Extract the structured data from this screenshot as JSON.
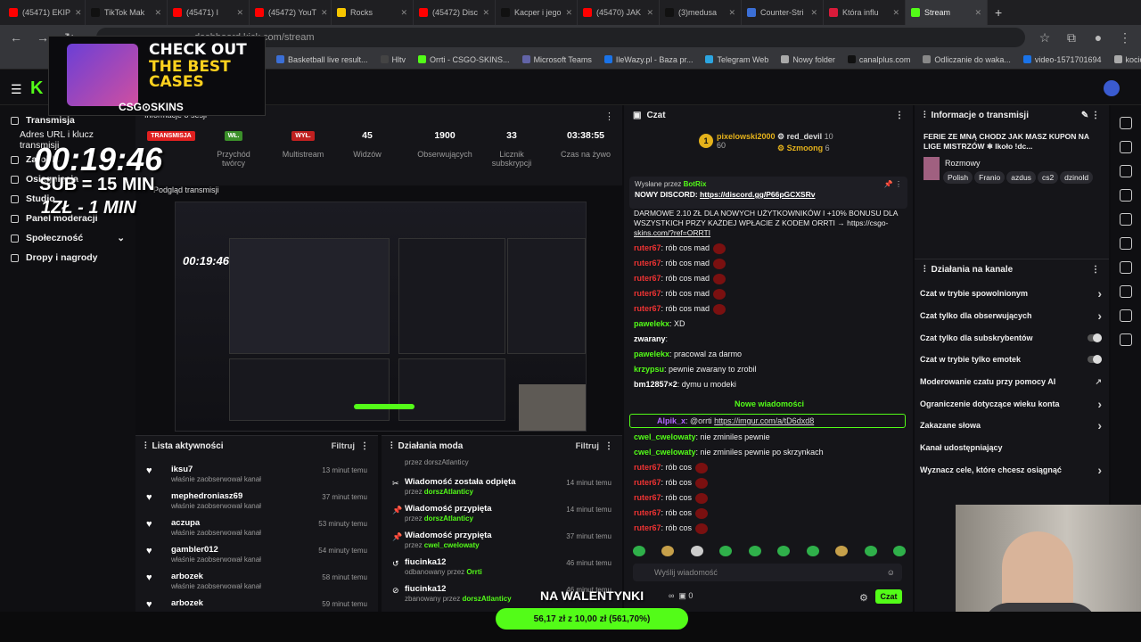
{
  "browser": {
    "tabs": [
      {
        "title": "(45471) EKIP",
        "color": "#ff0000"
      },
      {
        "title": "TikTok Mak",
        "color": "#111111"
      },
      {
        "title": "(45471) I",
        "color": "#ff0000"
      },
      {
        "title": "(45472) YouT",
        "color": "#ff0000"
      },
      {
        "title": "Rocks",
        "color": "#f7c600"
      },
      {
        "title": "(45472) Disc",
        "color": "#ff0000"
      },
      {
        "title": "Kacper i jego",
        "color": "#111111"
      },
      {
        "title": "(45470) JAK",
        "color": "#ff0000"
      },
      {
        "title": "(3)medusa",
        "color": "#111111"
      },
      {
        "title": "Counter-Stri",
        "color": "#3b6fd6"
      },
      {
        "title": "Która influ",
        "color": "#d81b3a"
      },
      {
        "title": "Stream",
        "color": "#53fc18"
      }
    ],
    "url": "dashboard.kick.com/stream",
    "bookmarks": [
      "Basketball live result...",
      "Hltv",
      "Orrti - CSGO-SKINS...",
      "Microsoft Teams",
      "IleWazy.pl - Baza pr...",
      "Telegram Web",
      "Nowy folder",
      "canalplus.com",
      "Odliczanie do waka...",
      "video-1571701694",
      "kocica"
    ]
  },
  "overlay": {
    "ad_line1": "CHECK OUT",
    "ad_line2": "THE BEST",
    "ad_line3": "CASES",
    "ad_logo": "CSG⊙SKINS",
    "timer": "00:19:46",
    "sub": "SUB = 15 MIN",
    "zl": "1ZŁ - 1 MIN",
    "valentine": "NA WALENTYNKI"
  },
  "nav": {
    "items": [
      "Transmisja",
      "Adres URL i klucz transmisji",
      "Zarobki",
      "Osiągnięcia",
      "Studio",
      "Panel moderacji",
      "Społeczność",
      "Dropy i nagrody"
    ]
  },
  "stats": {
    "header": "Informacje o sesji",
    "live_badge": "TRANSMISJA",
    "wl": "WŁ.",
    "wyl": "WYŁ.",
    "creator": "Przychód twórcy",
    "multistream": "Multistream",
    "viewers_val": "45",
    "viewers_label": "Widzów",
    "followers_val": "1900",
    "followers_label": "Obserwujących",
    "subs_val": "33",
    "subs_label": "Licznik subskrypcji",
    "time_val": "03:38:55",
    "time_label": "Czas na żywo"
  },
  "preview_title": "Podgląd transmisji",
  "activity": {
    "title": "Lista aktywności",
    "filter": "Filtruj",
    "rows": [
      {
        "name": "iksu7",
        "sub": "właśnie zaobserwował kanał",
        "time": "13 minut temu"
      },
      {
        "name": "mephedroniasz69",
        "sub": "właśnie zaobserwował kanał",
        "time": "37 minut temu"
      },
      {
        "name": "aczupa",
        "sub": "właśnie zaobserwował kanał",
        "time": "53 minuty temu"
      },
      {
        "name": "gambler012",
        "sub": "właśnie zaobserwował kanał",
        "time": "54 minuty temu"
      },
      {
        "name": "arbozek",
        "sub": "właśnie zaobserwował kanał",
        "time": "58 minut temu"
      },
      {
        "name": "arbozek",
        "sub": "",
        "time": "59 minut temu"
      }
    ]
  },
  "modlog": {
    "title": "Działania moda",
    "filter": "Filtruj",
    "top": "przez dorszAtlanticy",
    "rows": [
      {
        "name": "Wiadomość została odpięta",
        "by": "przez",
        "who": "dorszAtlanticy",
        "time": "14 minut temu"
      },
      {
        "name": "Wiadomość przypięta",
        "by": "przez",
        "who": "dorszAtlanticy",
        "time": "14 minut temu"
      },
      {
        "name": "Wiadomość przypięta",
        "by": "przez",
        "who": "cwel_cwelowaty",
        "time": "37 minut temu"
      },
      {
        "name": "fiucinka12",
        "by": "odbanowany przez",
        "who": "Orrti",
        "time": "46 minut temu"
      },
      {
        "name": "fiucinka12",
        "by": "zbanowany przez",
        "who": "dorszAtlanticy",
        "time": "46 minut temu"
      }
    ]
  },
  "chat": {
    "title": "Czat",
    "top1_name": "pixelowski2000",
    "top1_val": "60",
    "top2_name": "red_devil",
    "top2_val": "10",
    "top3_name": "Szmoong",
    "top3_val": "6",
    "pinned_by": "Wysłane przez",
    "pinned_bot": "BotRix",
    "pinned_text": "NOWY DISCORD:",
    "pinned_link": "https://discord.gg/P66pGCXSRv",
    "promo1": "DARMOWE 2.10 ZŁ DLA NOWYCH UŻYTKOWNIKÓW I +10% BONUSU DLA",
    "promo2": "WSZYSTKICH PRZY KAŻDEJ WPŁACIE Z KODEM ORRTI → https://csgo-",
    "promo3": "skins.com/?ref=ORRTI",
    "messages": [
      {
        "user": "ruter67",
        "text": ": rób cos mad",
        "color": "#e33"
      },
      {
        "user": "ruter67",
        "text": ": rób cos mad",
        "color": "#e33"
      },
      {
        "user": "ruter67",
        "text": ": rób cos mad",
        "color": "#e33"
      },
      {
        "user": "ruter67",
        "text": ": rób cos mad",
        "color": "#e33"
      },
      {
        "user": "ruter67",
        "text": ": rób cos mad",
        "color": "#e33"
      },
      {
        "user": "pawelekx",
        "text": ": XD",
        "color": "#53fc18"
      },
      {
        "user": "zwarany",
        "text": ":",
        "color": "#fff"
      },
      {
        "user": "pawelekx",
        "text": ": pracowal za darmo",
        "color": "#53fc18"
      },
      {
        "user": "krzypsu",
        "text": ": pewnie zwarany to zrobil",
        "color": "#53fc18"
      },
      {
        "user": "bm12857×2",
        "text": ": dymu u modeki",
        "color": "#fff"
      }
    ],
    "new_messages": "Nowe wiadomości",
    "hl_user": "Alpik_x",
    "hl_text": ": @orrti ",
    "hl_link": "https://imgur.com/a/tD6dxd8",
    "messages2": [
      {
        "user": "cwel_cwelowaty",
        "text": ": nie zminiles pewnie",
        "color": "#53fc18"
      },
      {
        "user": "cwel_cwelowaty",
        "text": ": nie zminiles pewnie po skrzynkach",
        "color": "#53fc18"
      },
      {
        "user": "ruter67",
        "text": ": rób cos",
        "color": "#e33"
      },
      {
        "user": "ruter67",
        "text": ": rób cos",
        "color": "#e33"
      },
      {
        "user": "ruter67",
        "text": ": rób cos",
        "color": "#e33"
      },
      {
        "user": "ruter67",
        "text": ": rób cos",
        "color": "#e33"
      },
      {
        "user": "ruter67",
        "text": ": rób cos",
        "color": "#e33"
      }
    ],
    "input_placeholder": "Wyślij wiadomość",
    "send": "Czat",
    "counter": "0"
  },
  "info": {
    "title": "Informacje o transmisji",
    "stream_title": "FERIE ZE MNĄ CHODZ JAK MASZ KUPON NA LIGE MISTRZÓW ❄ Ikoło !dc...",
    "category": "Rozmowy",
    "tags": [
      "Polish",
      "Franio",
      "azdus",
      "cs2",
      "dzinold"
    ],
    "actions_title": "Działania na kanale",
    "actions": [
      {
        "label": "Czat w trybie spowolnionym",
        "type": "arrow"
      },
      {
        "label": "Czat tylko dla obserwujących",
        "type": "arrow"
      },
      {
        "label": "Czat tylko dla subskrybentów",
        "type": "toggle"
      },
      {
        "label": "Czat w trybie tylko emotek",
        "type": "toggle"
      },
      {
        "label": "Moderowanie czatu przy pomocy AI",
        "type": "link"
      },
      {
        "label": "Ograniczenie dotyczące wieku konta",
        "type": "arrow"
      },
      {
        "label": "Zakazane słowa",
        "type": "arrow"
      },
      {
        "label": "Kanał udostępniający",
        "type": "none"
      },
      {
        "label": "Wyznacz cele, które chcesz osiągnąć",
        "type": "arrow"
      }
    ]
  },
  "goal": "56,17 zł z 10,00 zł (561,70%)",
  "colors": {
    "accent": "#53fc18",
    "bg": "#0d0d10",
    "panel": "#151519"
  }
}
